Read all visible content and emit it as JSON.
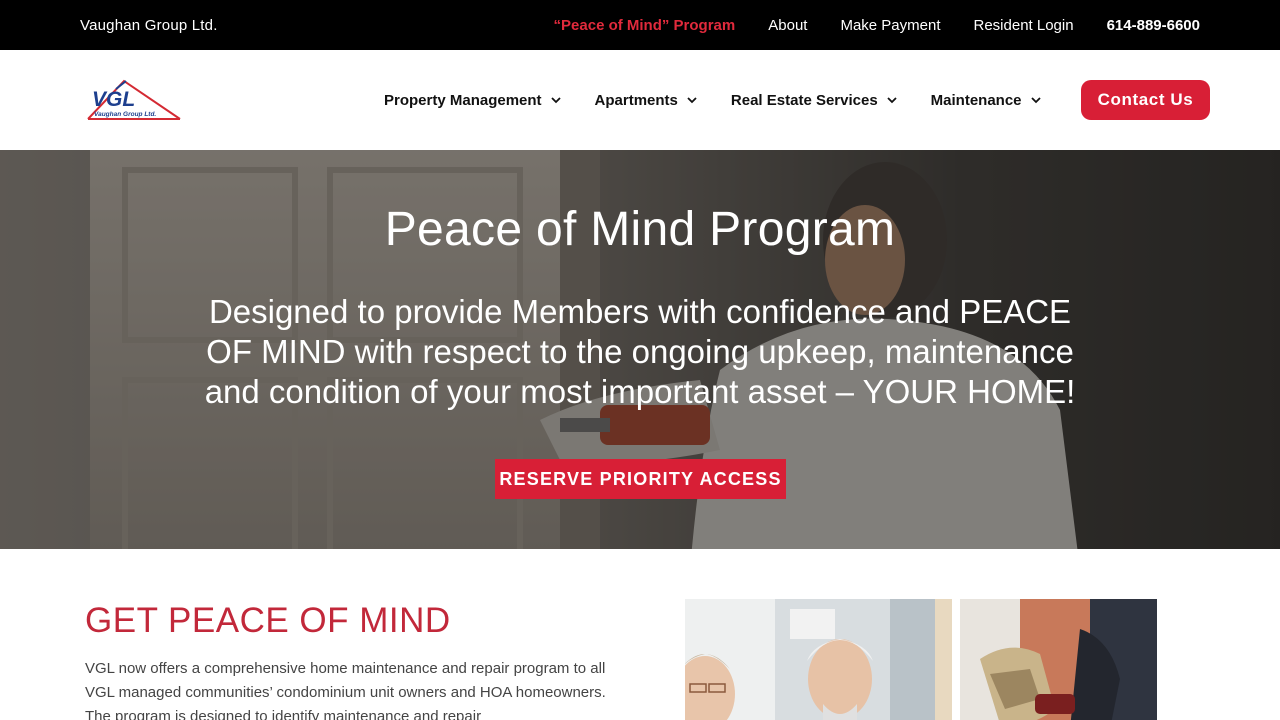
{
  "topbar": {
    "company": "Vaughan Group Ltd.",
    "links": [
      "“Peace of Mind” Program",
      "About",
      "Make Payment",
      "Resident Login",
      "614-889-6600"
    ]
  },
  "logo": {
    "mark": "VGL",
    "subtitle": "Vaughan Group Ltd."
  },
  "nav": {
    "items": [
      "Property Management",
      "Apartments",
      "Real Estate Services",
      "Maintenance"
    ],
    "contact_label": "Contact Us"
  },
  "hero": {
    "title": "Peace of Mind Program",
    "subtitle": "Designed to provide Members with confidence and PEACE OF MIND with respect to the ongoing upkeep, maintenance and condition of your most important asset – YOUR HOME!",
    "cta_label": "RESERVE PRIORITY ACCESS"
  },
  "section": {
    "heading": "GET PEACE OF MIND",
    "body": "VGL now offers a comprehensive home maintenance and repair program to all VGL managed communities’ condominium unit owners and HOA homeowners. The program is designed to identify maintenance and repair"
  },
  "colors": {
    "accent": "#d81f36",
    "topbar_bg": "#000000",
    "heading": "#c2283a"
  },
  "icons": {
    "nav_dropdown": "chevron-down-icon"
  }
}
